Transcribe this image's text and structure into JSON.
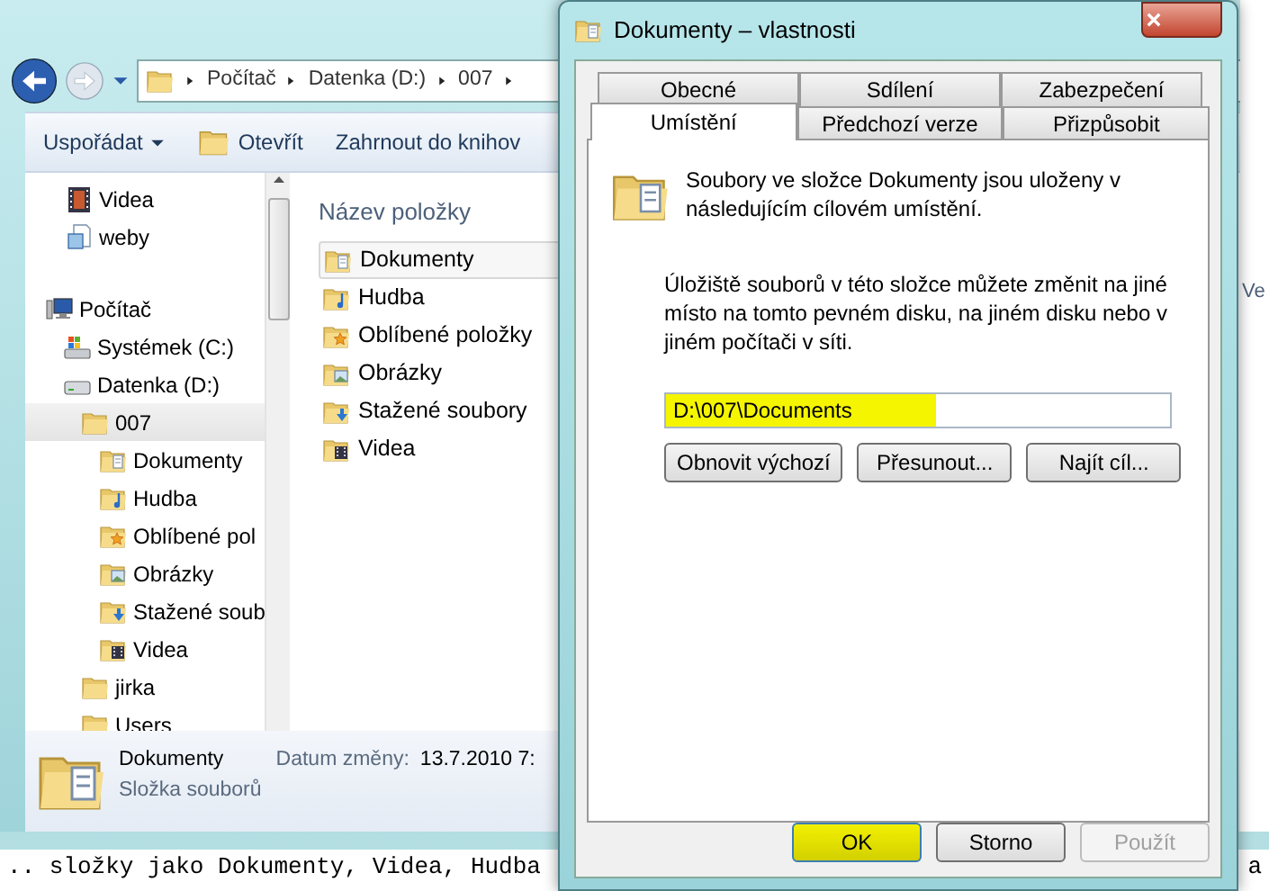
{
  "explorer": {
    "breadcrumb": [
      "Počítač",
      "Datenka (D:)",
      "007"
    ],
    "toolbar": [
      {
        "label": "Uspořádat",
        "kind": "menu"
      },
      {
        "label": "Otevřít",
        "kind": "open"
      },
      {
        "label": "Zahrnout do knihov",
        "kind": "plain"
      }
    ],
    "nav_tree": [
      {
        "label": "Videa",
        "kind": "library-video",
        "selected": false
      },
      {
        "label": "weby",
        "kind": "library",
        "selected": false
      },
      {
        "label": "Počítač",
        "kind": "computer",
        "selected": false,
        "children": [
          {
            "label": "Systémek (C:)",
            "kind": "system-drive",
            "selected": false
          },
          {
            "label": "Datenka (D:)",
            "kind": "drive",
            "selected": false,
            "children": [
              {
                "label": "007",
                "kind": "folder",
                "selected": true,
                "children": [
                  {
                    "label": "Dokumenty",
                    "kind": "documents",
                    "selected": false
                  },
                  {
                    "label": "Hudba",
                    "kind": "music",
                    "selected": false
                  },
                  {
                    "label": "Oblíbené pol",
                    "kind": "favorites",
                    "selected": false
                  },
                  {
                    "label": "Obrázky",
                    "kind": "pictures",
                    "selected": false
                  },
                  {
                    "label": "Stažené soub",
                    "kind": "downloads",
                    "selected": false
                  },
                  {
                    "label": "Videa",
                    "kind": "videos",
                    "selected": false
                  }
                ]
              },
              {
                "label": "jirka",
                "kind": "folder",
                "selected": false
              },
              {
                "label": "Users",
                "kind": "folder",
                "selected": false
              }
            ]
          }
        ]
      }
    ],
    "columns": [
      "Název položky",
      "Ve"
    ],
    "items": [
      {
        "label": "Dokumenty",
        "kind": "documents",
        "selected": true
      },
      {
        "label": "Hudba",
        "kind": "music",
        "selected": false
      },
      {
        "label": "Oblíbené položky",
        "kind": "favorites",
        "selected": false
      },
      {
        "label": "Obrázky",
        "kind": "pictures",
        "selected": false
      },
      {
        "label": "Stažené soubory",
        "kind": "downloads",
        "selected": false
      },
      {
        "label": "Videa",
        "kind": "videos",
        "selected": false
      }
    ],
    "details": {
      "name": "Dokumenty",
      "type": "Složka souborů",
      "date_label": "Datum změny:",
      "date_value": "13.7.2010 7:"
    }
  },
  "background_text": {
    "left": ".. složky jako Dokumenty, Videa, Hudba",
    "right": "a"
  },
  "dialog": {
    "title": "Dokumenty – vlastnosti",
    "tab_rows": [
      [
        {
          "label": "Obecné",
          "selected": false
        },
        {
          "label": "Sdílení",
          "selected": false
        },
        {
          "label": "Zabezpečení",
          "selected": false
        }
      ],
      [
        {
          "label": "Umístění",
          "selected": true
        },
        {
          "label": "Předchozí verze",
          "selected": false
        },
        {
          "label": "Přizpůsobit",
          "selected": false
        }
      ]
    ],
    "intro": "Soubory ve složce Dokumenty jsou uloženy v následujícím cílovém umístění.",
    "info": "Úložiště souborů v této složce můžete změnit na jiné místo na tomto pevném disku, na jiném disku nebo v jiném počítači v síti.",
    "path": {
      "value": "D:\\007\\Documents",
      "highlighted": true
    },
    "actions": [
      "Obnovit výchozí",
      "Přesunout...",
      "Najít cíl..."
    ],
    "buttons": [
      {
        "label": "OK",
        "highlighted": true,
        "disabled": false
      },
      {
        "label": "Storno",
        "highlighted": false,
        "disabled": false
      },
      {
        "label": "Použít",
        "highlighted": false,
        "disabled": true
      }
    ]
  }
}
